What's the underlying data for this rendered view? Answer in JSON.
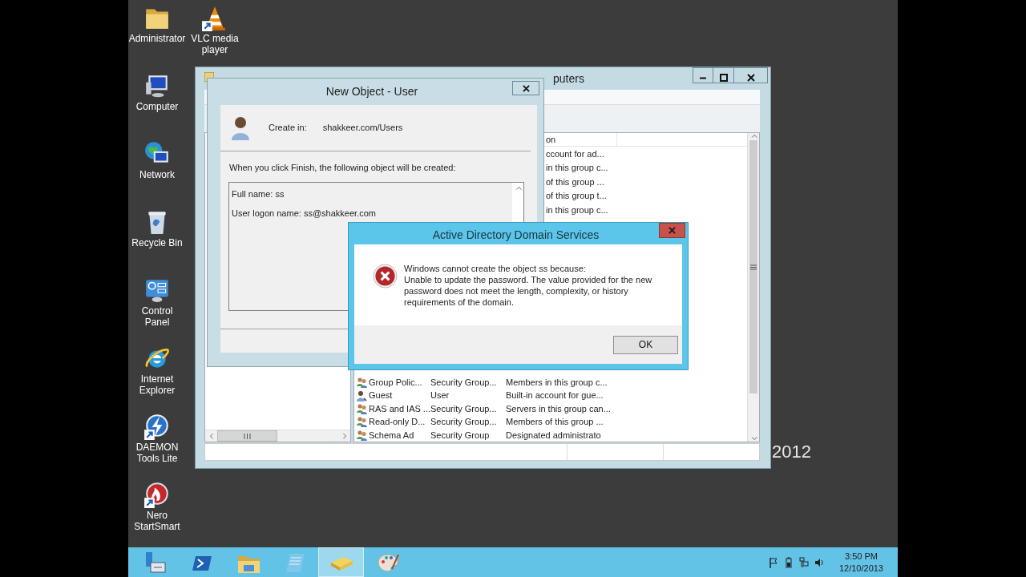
{
  "desktop": {
    "icons": [
      {
        "label": "Administrator",
        "kind": "folder",
        "shortcut": false
      },
      {
        "label": "VLC media player",
        "kind": "cone",
        "shortcut": true
      },
      {
        "label": "Computer",
        "kind": "monitor",
        "shortcut": false
      },
      {
        "label": "Network",
        "kind": "globe",
        "shortcut": false
      },
      {
        "label": "Recycle Bin",
        "kind": "bin",
        "shortcut": false
      },
      {
        "label": "Control Panel",
        "kind": "panel",
        "shortcut": false
      },
      {
        "label": "Internet Explorer",
        "kind": "browser",
        "shortcut": false
      },
      {
        "label": "DAEMON Tools Lite",
        "kind": "bolt",
        "shortcut": true
      },
      {
        "label": "Nero StartSmart",
        "kind": "flame",
        "shortcut": true
      }
    ],
    "wallpaper_text": "2012"
  },
  "main_window": {
    "title": "puters",
    "list": {
      "header": "on",
      "rows": [
        {
          "kind": "partial",
          "description": "ccount for ad..."
        },
        {
          "kind": "partial",
          "description": "in this group c..."
        },
        {
          "kind": "partial",
          "description": "of this group ..."
        },
        {
          "kind": "partial",
          "description": "of this group t..."
        },
        {
          "kind": "partial",
          "description": "in this group c..."
        },
        {
          "kind": "group",
          "name": "Group Polic...",
          "type": "Security Group...",
          "description": "Members in this group c..."
        },
        {
          "kind": "user",
          "name": "Guest",
          "type": "User",
          "description": "Built-in account for gue..."
        },
        {
          "kind": "group",
          "name": "RAS and IAS ...",
          "type": "Security Group...",
          "description": "Servers in this group can..."
        },
        {
          "kind": "group",
          "name": "Read-only D...",
          "type": "Security Group...",
          "description": "Members of this group ..."
        },
        {
          "kind": "group",
          "name": "Schema Ad",
          "type": "Security Group",
          "description": "Designated administrato"
        }
      ]
    }
  },
  "new_object_dialog": {
    "title": "New Object - User",
    "create_in_label": "Create in:",
    "create_in_value": "shakkeer.com/Users",
    "instruction": "When you click Finish, the following object will be created:",
    "summary": [
      "Full name: ss",
      "User logon name: ss@shakkeer.com"
    ]
  },
  "error_dialog": {
    "title": "Active Directory Domain Services",
    "message": [
      "Windows cannot create the object ss because:",
      "Unable to update the password. The value provided for the new password does not meet the length, complexity, or history requirements of the domain."
    ],
    "buttons": [
      "OK"
    ]
  },
  "taskbar": {
    "items": [
      {
        "kind": "server",
        "selected": false
      },
      {
        "kind": "shell",
        "selected": false
      },
      {
        "kind": "folder",
        "selected": false
      },
      {
        "kind": "notepad",
        "selected": false
      },
      {
        "kind": "book",
        "selected": true
      },
      {
        "kind": "palette",
        "selected": false
      }
    ],
    "clock": {
      "time": "3:50 PM",
      "date": "12/10/2013"
    }
  }
}
